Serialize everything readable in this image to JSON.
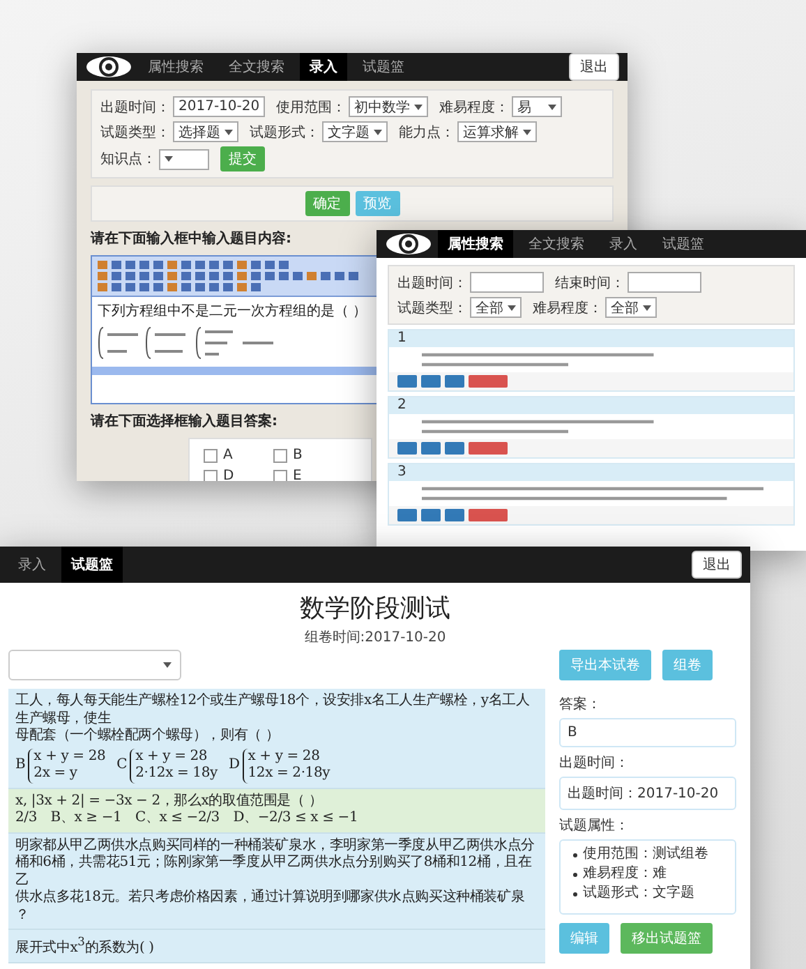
{
  "entry_window": {
    "nav": [
      {
        "label": "属性搜索",
        "selected": false
      },
      {
        "label": "全文搜索",
        "selected": false
      },
      {
        "label": "录入",
        "selected": true
      },
      {
        "label": "试题篮",
        "selected": false
      }
    ],
    "logout": "退出",
    "fields": [
      {
        "label": "出题时间：",
        "value": "2017-10-20",
        "kind": "input"
      },
      {
        "label": "使用范围：",
        "value": "初中数学",
        "kind": "select"
      },
      {
        "label": "难易程度：",
        "value": "易",
        "kind": "select"
      },
      {
        "label": "试题类型：",
        "value": "选择题",
        "kind": "select"
      },
      {
        "label": "试题形式：",
        "value": "文字题",
        "kind": "select"
      },
      {
        "label": "能力点：",
        "value": "运算求解",
        "kind": "select"
      },
      {
        "label": "知识点：",
        "kind": "select"
      }
    ],
    "submit": "提交",
    "actions": [
      {
        "label": "确定",
        "kind": "confirm"
      },
      {
        "label": "预览",
        "kind": "preview"
      }
    ],
    "editor_label": "请在下面输入框中输入题目内容:",
    "editor_text": "下列方程组中不是二元一次方程组的是（ ）",
    "answer_label": "请在下面选择框输入题目答案:",
    "answer_options": [
      {
        "label": "A",
        "checked": false
      },
      {
        "label": "B",
        "checked": false
      },
      {
        "label": "D",
        "checked": false
      },
      {
        "label": "E",
        "checked": false
      }
    ]
  },
  "search_window": {
    "nav": [
      {
        "label": "属性搜索",
        "selected": true
      },
      {
        "label": "全文搜索",
        "selected": false
      },
      {
        "label": "录入",
        "selected": false
      },
      {
        "label": "试题篮",
        "selected": false
      }
    ],
    "filters": [
      {
        "label": "出题时间：",
        "kind": "input"
      },
      {
        "label": "结束时间：",
        "kind": "input"
      },
      {
        "label": "试题类型：",
        "value": "全部",
        "kind": "select"
      },
      {
        "label": "难易程度：",
        "value": "全部",
        "kind": "select"
      }
    ],
    "cards": [
      {
        "number": "1"
      },
      {
        "number": "2"
      },
      {
        "number": "3"
      }
    ]
  },
  "exam_window": {
    "nav": [
      {
        "label": "录入",
        "selected": false
      },
      {
        "label": "试题篮",
        "selected": true
      }
    ],
    "logout": "退出",
    "title": "数学阶段测试",
    "date": "组卷时间:2017-10-20",
    "export_button": "导出本试卷",
    "compose_button": "组卷",
    "questions": [
      {
        "selected": false,
        "lines": [
          "工人，每人每天能生产螺栓12个或生产螺母18个，设安排x名工人生产螺栓，y名工人生产螺母，使生",
          "母配套（一个螺栓配两个螺母），则有（  ）"
        ],
        "systems": [
          {
            "letter": "B",
            "rows": [
              "x + y = 28",
              "2x = y"
            ]
          },
          {
            "letter": "C",
            "rows": [
              "x + y = 28",
              "2·12x = 18y"
            ]
          },
          {
            "letter": "D",
            "rows": [
              "x + y = 28",
              "12x = 2·18y"
            ]
          }
        ]
      },
      {
        "selected": true,
        "lines": [
          "x, |3x + 2| = −3x − 2，那么x的取值范围是（  ）",
          "2/3　B、x ≥ −1　C、x ≤ −2/3　D、−2/3 ≤ x ≤ −1"
        ]
      },
      {
        "selected": false,
        "lines": [
          "明家都从甲乙两供水点购买同样的一种桶装矿泉水，李明家第一季度从甲乙两供水点分",
          "桶和6桶，共需花51元；陈刚家第一季度从甲乙两供水点分别购买了8桶和12桶，且在乙",
          "供水点多花18元。若只考虑价格因素，通过计算说明到哪家供水点购买这种桶装矿泉",
          "？"
        ]
      },
      {
        "selected": false,
        "lines": [
          "展开式中x$^{3}$的系数为(        )"
        ]
      }
    ],
    "answer": {
      "label": "答案：",
      "value": "B"
    },
    "time": {
      "label": "出题时间：",
      "value": "出题时间：2017-10-20"
    },
    "attributes": {
      "label": "试题属性：",
      "items": [
        "使用范围：测试组卷",
        "难易程度：难",
        "试题形式：文字题"
      ]
    },
    "edit_button": "编辑",
    "remove_button": "移出试题篮"
  }
}
